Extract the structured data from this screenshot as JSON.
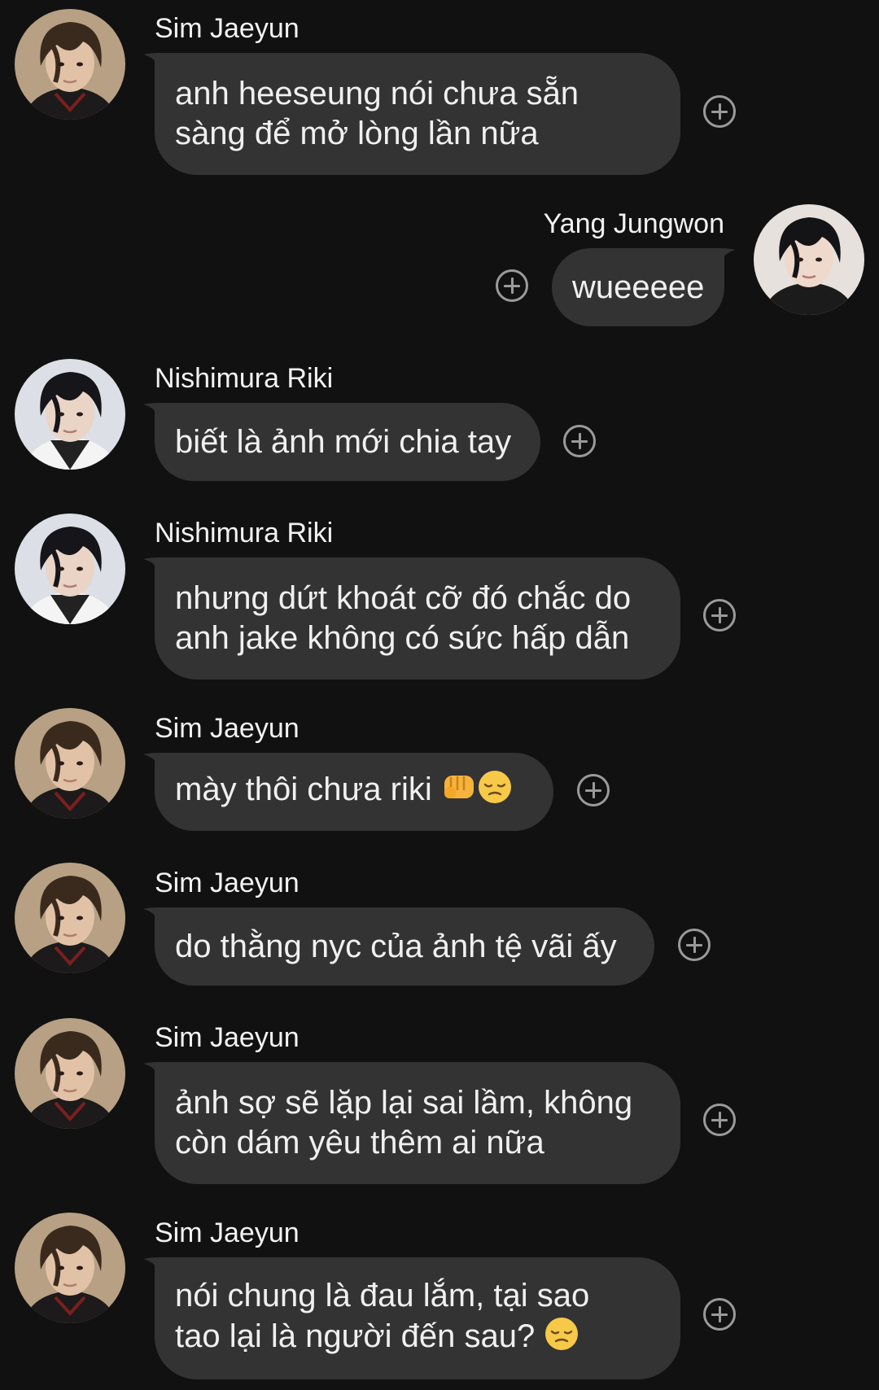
{
  "colors": {
    "background": "#111111",
    "bubble": "#333333",
    "text": "#f0f0f0",
    "react_icon": "#9a9a9a"
  },
  "messages": [
    {
      "sender": "Sim Jaeyun",
      "side": "left",
      "avatar": "jaeyun-avatar",
      "lines": [
        "anh heeseung nói chưa sẵn",
        "sàng để mở lòng lần nữa"
      ]
    },
    {
      "sender": "Yang Jungwon",
      "side": "right",
      "avatar": "jungwon-avatar",
      "lines": [
        "wueeeee"
      ]
    },
    {
      "sender": "Nishimura Riki",
      "side": "left",
      "avatar": "riki-avatar",
      "lines": [
        "biết là ảnh mới chia tay"
      ]
    },
    {
      "sender": "Nishimura Riki",
      "side": "left",
      "avatar": "riki-avatar",
      "lines": [
        "nhưng dứt khoát cỡ đó chắc do",
        "anh jake không có sức hấp dẫn"
      ]
    },
    {
      "sender": "Sim Jaeyun",
      "side": "left",
      "avatar": "jaeyun-avatar",
      "lines": [
        "mày thôi chưa riki "
      ],
      "emojis": [
        "fist-emoji",
        "pensive-emoji"
      ]
    },
    {
      "sender": "Sim Jaeyun",
      "side": "left",
      "avatar": "jaeyun-avatar",
      "lines": [
        "do thằng nyc của ảnh tệ vãi ấy"
      ]
    },
    {
      "sender": "Sim Jaeyun",
      "side": "left",
      "avatar": "jaeyun-avatar",
      "lines": [
        "ảnh sợ sẽ lặp lại sai lầm, không",
        "còn dám yêu thêm ai nữa"
      ]
    },
    {
      "sender": "Sim Jaeyun",
      "side": "left",
      "avatar": "jaeyun-avatar",
      "lines": [
        "nói chung là đau lắm, tại sao",
        "tao lại là người đến sau? "
      ],
      "emojis": [
        "pensive-emoji"
      ]
    }
  ]
}
